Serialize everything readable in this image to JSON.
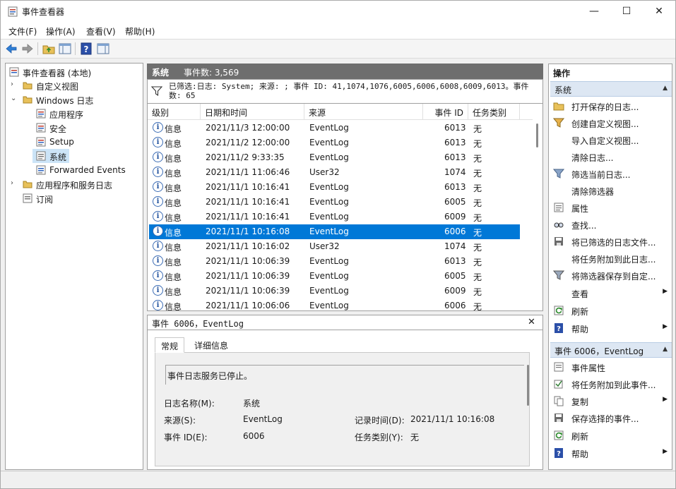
{
  "window": {
    "title": "事件查看器"
  },
  "window_controls": {
    "minimize": "—",
    "maximize": "☐",
    "close": "✕"
  },
  "menu": [
    "文件(F)",
    "操作(A)",
    "查看(V)",
    "帮助(H)"
  ],
  "tree": {
    "root": "事件查看器 (本地)",
    "custom_views": "自定义视图",
    "windows_logs": "Windows 日志",
    "logs": [
      "应用程序",
      "安全",
      "Setup",
      "系统",
      "Forwarded Events"
    ],
    "apps_services": "应用程序和服务日志",
    "subscriptions": "订阅"
  },
  "log_header": {
    "name": "系统",
    "count": "事件数: 3,569"
  },
  "filter_text": "已筛选:日志: System; 来源: ; 事件 ID: 41,1074,1076,6005,6006,6008,6009,6013。事件数: 65",
  "columns": [
    "级别",
    "日期和时间",
    "来源",
    "事件 ID",
    "任务类别"
  ],
  "rows": [
    {
      "level": "信息",
      "datetime": "2021/11/3 12:00:00",
      "source": "EventLog",
      "id": "6013",
      "category": "无"
    },
    {
      "level": "信息",
      "datetime": "2021/11/2 12:00:00",
      "source": "EventLog",
      "id": "6013",
      "category": "无"
    },
    {
      "level": "信息",
      "datetime": "2021/11/2 9:33:35",
      "source": "EventLog",
      "id": "6013",
      "category": "无"
    },
    {
      "level": "信息",
      "datetime": "2021/11/1 11:06:46",
      "source": "User32",
      "id": "1074",
      "category": "无"
    },
    {
      "level": "信息",
      "datetime": "2021/11/1 10:16:41",
      "source": "EventLog",
      "id": "6013",
      "category": "无"
    },
    {
      "level": "信息",
      "datetime": "2021/11/1 10:16:41",
      "source": "EventLog",
      "id": "6005",
      "category": "无"
    },
    {
      "level": "信息",
      "datetime": "2021/11/1 10:16:41",
      "source": "EventLog",
      "id": "6009",
      "category": "无"
    },
    {
      "level": "信息",
      "datetime": "2021/11/1 10:16:08",
      "source": "EventLog",
      "id": "6006",
      "category": "无"
    },
    {
      "level": "信息",
      "datetime": "2021/11/1 10:16:02",
      "source": "User32",
      "id": "1074",
      "category": "无"
    },
    {
      "level": "信息",
      "datetime": "2021/11/1 10:06:39",
      "source": "EventLog",
      "id": "6013",
      "category": "无"
    },
    {
      "level": "信息",
      "datetime": "2021/11/1 10:06:39",
      "source": "EventLog",
      "id": "6005",
      "category": "无"
    },
    {
      "level": "信息",
      "datetime": "2021/11/1 10:06:39",
      "source": "EventLog",
      "id": "6009",
      "category": "无"
    },
    {
      "level": "信息",
      "datetime": "2021/11/1 10:06:06",
      "source": "EventLog",
      "id": "6006",
      "category": "无"
    }
  ],
  "detail": {
    "title": "事件 6006，EventLog",
    "close": "✕",
    "tabs": [
      "常规",
      "详细信息"
    ],
    "description": "事件日志服务已停止。",
    "log_name_label": "日志名称(M):",
    "log_name": "系统",
    "source_label": "来源(S):",
    "source": "EventLog",
    "logged_label": "记录时间(D):",
    "logged": "2021/11/1 10:16:08",
    "event_id_label": "事件 ID(E):",
    "event_id": "6006",
    "task_label": "任务类别(Y):",
    "task": "无"
  },
  "actions": {
    "title": "操作",
    "group1": "系统",
    "group1_items": [
      "打开保存的日志...",
      "创建自定义视图...",
      "导入自定义视图...",
      "清除日志...",
      "筛选当前日志...",
      "清除筛选器",
      "属性",
      "查找...",
      "将已筛选的日志文件...",
      "将任务附加到此日志...",
      "将筛选器保存到自定...",
      "查看",
      "刷新",
      "帮助"
    ],
    "group2": "事件 6006，EventLog",
    "group2_items": [
      "事件属性",
      "将任务附加到此事件...",
      "复制",
      "保存选择的事件...",
      "刷新",
      "帮助"
    ]
  },
  "colors": {
    "selection": "#0078d7",
    "header_gray": "#6e6e6e",
    "action_group": "#dde7f3"
  }
}
